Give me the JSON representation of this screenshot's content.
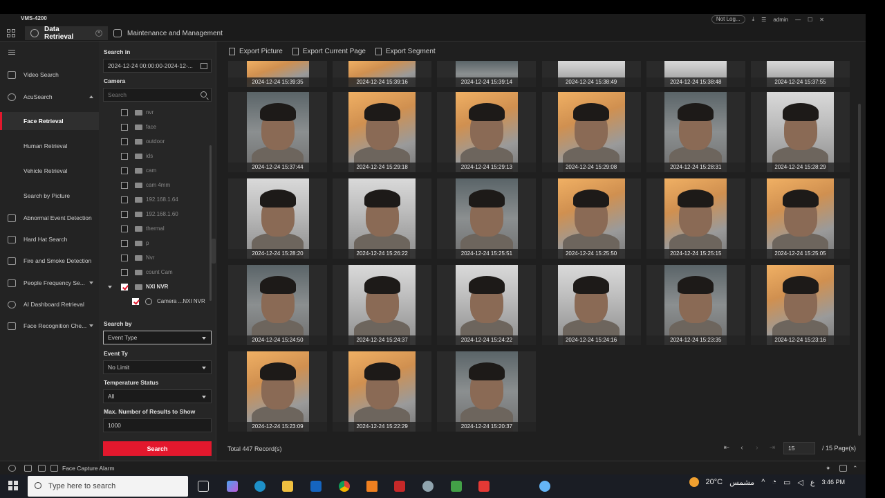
{
  "titlebar": {
    "app_name": "VMS-4200",
    "login_pill": "Not Log...",
    "user": "admin"
  },
  "tabs": [
    {
      "label": "Data Retrieval",
      "active": true
    },
    {
      "label": "Maintenance and Management",
      "active": false
    }
  ],
  "sidebar": {
    "items": [
      {
        "label": "Video Search",
        "icon": "video-search-icon"
      },
      {
        "label": "AcuSearch",
        "icon": "acusearch-icon",
        "expanded": true
      },
      {
        "label": "Face Retrieval",
        "active": true
      },
      {
        "label": "Human Retrieval"
      },
      {
        "label": "Vehicle Retrieval"
      },
      {
        "label": "Search by Picture"
      },
      {
        "label": "Abnormal Event Detection",
        "icon": "event-icon"
      },
      {
        "label": "Hard Hat Search",
        "icon": "hardhat-icon"
      },
      {
        "label": "Fire and Smoke Detection",
        "icon": "fire-icon"
      },
      {
        "label": "People Frequency Se...",
        "icon": "people-icon"
      },
      {
        "label": "AI Dashboard Retrieval",
        "icon": "dashboard-icon"
      },
      {
        "label": "Face Recognition Che...",
        "icon": "face-recognition-icon"
      }
    ]
  },
  "filter": {
    "search_in_label": "Search in",
    "search_in_value": "2024-12-24 00:00:00-2024-12-...",
    "camera_label": "Camera",
    "camera_search_placeholder": "Search",
    "tree": [
      {
        "label": "nvr",
        "checked": false
      },
      {
        "label": "face",
        "checked": false
      },
      {
        "label": "outdoor",
        "checked": false
      },
      {
        "label": "ids",
        "checked": false
      },
      {
        "label": "cam",
        "checked": false
      },
      {
        "label": "cam 4mm",
        "checked": false
      },
      {
        "label": "192.168.1.64",
        "checked": false
      },
      {
        "label": "192.168.1.60",
        "checked": false
      },
      {
        "label": "thermal",
        "checked": false
      },
      {
        "label": "p",
        "checked": false
      },
      {
        "label": "Nvr",
        "checked": false
      },
      {
        "label": "count Cam",
        "checked": false
      },
      {
        "label": "NXI NVR",
        "checked": true,
        "expanded": true
      },
      {
        "label": "Camera ...NXI NVR",
        "checked": true,
        "child": true
      }
    ],
    "search_by_label": "Search by",
    "search_by_value": "Event Type",
    "event_type_label": "Event Ty",
    "event_type_value": "No Limit",
    "temperature_label": "Temperature Status",
    "temperature_value": "All",
    "max_results_label": "Max. Number of Results to Show",
    "max_results_value": "1000",
    "search_button": "Search"
  },
  "toolbar": {
    "export_picture": "Export Picture",
    "export_current_page": "Export Current Page",
    "export_segment": "Export Segment"
  },
  "results": [
    "2024-12-24 15:39:35",
    "2024-12-24 15:39:16",
    "2024-12-24 15:39:14",
    "2024-12-24 15:38:49",
    "2024-12-24 15:38:48",
    "2024-12-24 15:37:55",
    "2024-12-24 15:37:44",
    "2024-12-24 15:29:18",
    "2024-12-24 15:29:13",
    "2024-12-24 15:29:08",
    "2024-12-24 15:28:31",
    "2024-12-24 15:28:29",
    "2024-12-24 15:28:20",
    "2024-12-24 15:26:22",
    "2024-12-24 15:25:51",
    "2024-12-24 15:25:50",
    "2024-12-24 15:25:15",
    "2024-12-24 15:25:05",
    "2024-12-24 15:24:50",
    "2024-12-24 15:24:37",
    "2024-12-24 15:24:22",
    "2024-12-24 15:24:16",
    "2024-12-24 15:23:35",
    "2024-12-24 15:23:16",
    "2024-12-24 15:23:09",
    "2024-12-24 15:22:29",
    "2024-12-24 15:20:37"
  ],
  "footer": {
    "total": "Total 447 Record(s)",
    "page_value": "15",
    "page_total": "/ 15 Page(s)"
  },
  "statusbar": {
    "alarm_text": "Face Capture Alarm"
  },
  "taskbar": {
    "search_placeholder": "Type here to search",
    "weather": "20°C",
    "weather_text": "مشمس",
    "time": "3:46 PM",
    "lang": "ع"
  }
}
